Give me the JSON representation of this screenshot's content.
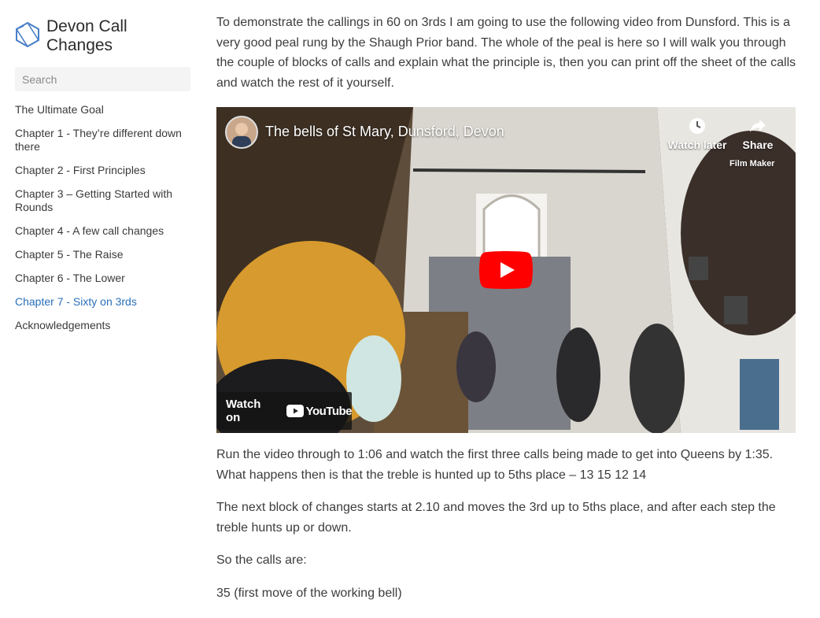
{
  "sidebar": {
    "brand_title": "Devon Call Changes",
    "search_placeholder": "Search",
    "items": [
      {
        "label": "The Ultimate Goal"
      },
      {
        "label": "Chapter 1 - They’re different down there"
      },
      {
        "label": "Chapter 2 - First Principles"
      },
      {
        "label": "Chapter 3 – Getting Started with Rounds"
      },
      {
        "label": "Chapter 4 - A few call changes"
      },
      {
        "label": "Chapter 5 - The Raise"
      },
      {
        "label": "Chapter 6 - The Lower"
      },
      {
        "label": "Chapter 7 - Sixty on 3rds",
        "active": true
      },
      {
        "label": "Acknowledgements"
      }
    ]
  },
  "main": {
    "intro": "To demonstrate the callings in 60 on 3rds I am going to use the following video from Dunsford. This is a very good peal rung by the Shaugh Prior band. The whole of the peal is here so I will walk you through the couple of blocks of calls and explain what the principle is, then you can print off the sheet of the calls and watch the rest of it yourself.",
    "video": {
      "title": "The bells of St Mary, Dunsford, Devon",
      "watch_later": "Watch later",
      "share": "Share",
      "film_maker": "Film Maker",
      "watch_on": "Watch on",
      "youtube": "YouTube"
    },
    "para2": "Run the video through to 1:06 and watch the first three calls being made to get into Queens by 1:35. What happens then is that the treble is hunted up to 5ths place – 13 15 12 14",
    "para3": "The next block of changes starts at 2.10 and moves the 3rd up to 5ths place, and after each step the treble hunts up or down.",
    "para4": "So the calls are:",
    "para5": "35 (first move of the working bell)"
  },
  "colors": {
    "accent": "#2a6fba",
    "logo": "#4a80c8",
    "youtube_red": "#ff0000"
  }
}
